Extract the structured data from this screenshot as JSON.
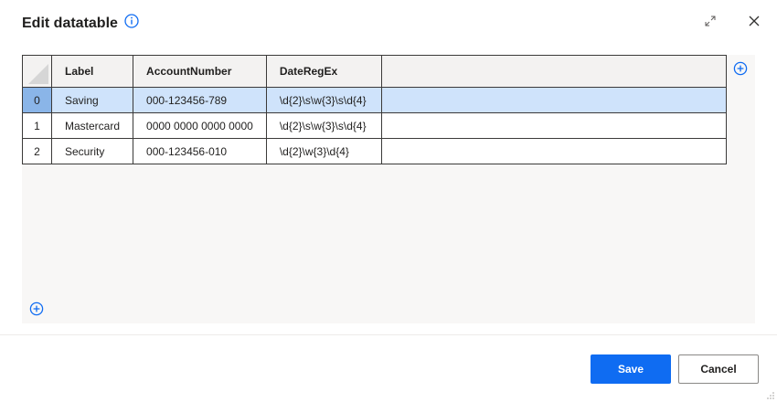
{
  "dialog": {
    "title": "Edit datatable"
  },
  "table": {
    "columns": [
      "Label",
      "AccountNumber",
      "DateRegEx"
    ],
    "rows": [
      {
        "index": "0",
        "cells": [
          "Saving",
          "000-123456-789",
          "\\d{2}\\s\\w{3}\\s\\d{4}"
        ],
        "selected": true
      },
      {
        "index": "1",
        "cells": [
          "Mastercard",
          "0000 0000 0000 0000",
          "\\d{2}\\s\\w{3}\\s\\d{4}"
        ],
        "selected": false
      },
      {
        "index": "2",
        "cells": [
          "Security",
          "000-123456-010",
          "\\d{2}\\w{3}\\d{4}"
        ],
        "selected": false
      }
    ]
  },
  "footer": {
    "save_label": "Save",
    "cancel_label": "Cancel"
  },
  "icons": {
    "info": "info-icon",
    "expand": "expand-icon",
    "close": "close-icon",
    "add_column": "add-column-icon",
    "add_row": "add-row-icon"
  },
  "colors": {
    "accent": "#0f6cf2",
    "selected_row": "#cfe3fb",
    "selected_index": "#8ab5e8"
  }
}
